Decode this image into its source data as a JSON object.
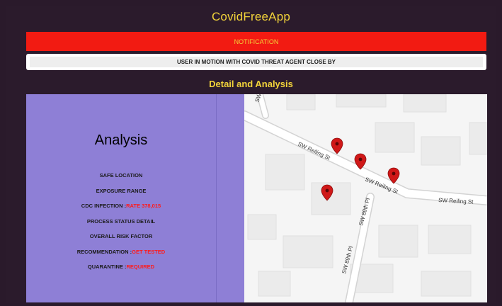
{
  "app": {
    "title": "CovidFreeApp"
  },
  "notification": {
    "label": "NOTIFICATION"
  },
  "alert": {
    "message": "USER IN MOTION WITH COVID THREAT AGENT CLOSE BY"
  },
  "section": {
    "title": "Detail and Analysis"
  },
  "analysis": {
    "heading": "Analysis",
    "rows": [
      {
        "label": "SAFE LOCATION",
        "value": ""
      },
      {
        "label": "EXPOSURE RANGE",
        "value": ""
      },
      {
        "label": "CDC INFECTION :",
        "value": "RATE 378,015"
      },
      {
        "label": "PROCESS STATUS DETAIL",
        "value": ""
      },
      {
        "label": "OVERALL RISK FACTOR",
        "value": ""
      },
      {
        "label": "RECOMMENDATION :",
        "value": "GET TESTED"
      },
      {
        "label": "QUARANTINE :",
        "value": "REQUIRED"
      }
    ]
  },
  "map": {
    "streets": {
      "reiling_1": "SW Reiling St",
      "reiling_2": "SW Reiling St",
      "reiling_3": "SW Reiling St",
      "ninety_1": "SW 89th Pl",
      "ninety_2": "SW 89th Pl",
      "corner": "SW"
    },
    "pin_color": "#d01818"
  },
  "colors": {
    "background": "#2a1a2b",
    "accent": "#f2d33a",
    "notification": "#f21b12",
    "panel": "#8e7fd6"
  }
}
